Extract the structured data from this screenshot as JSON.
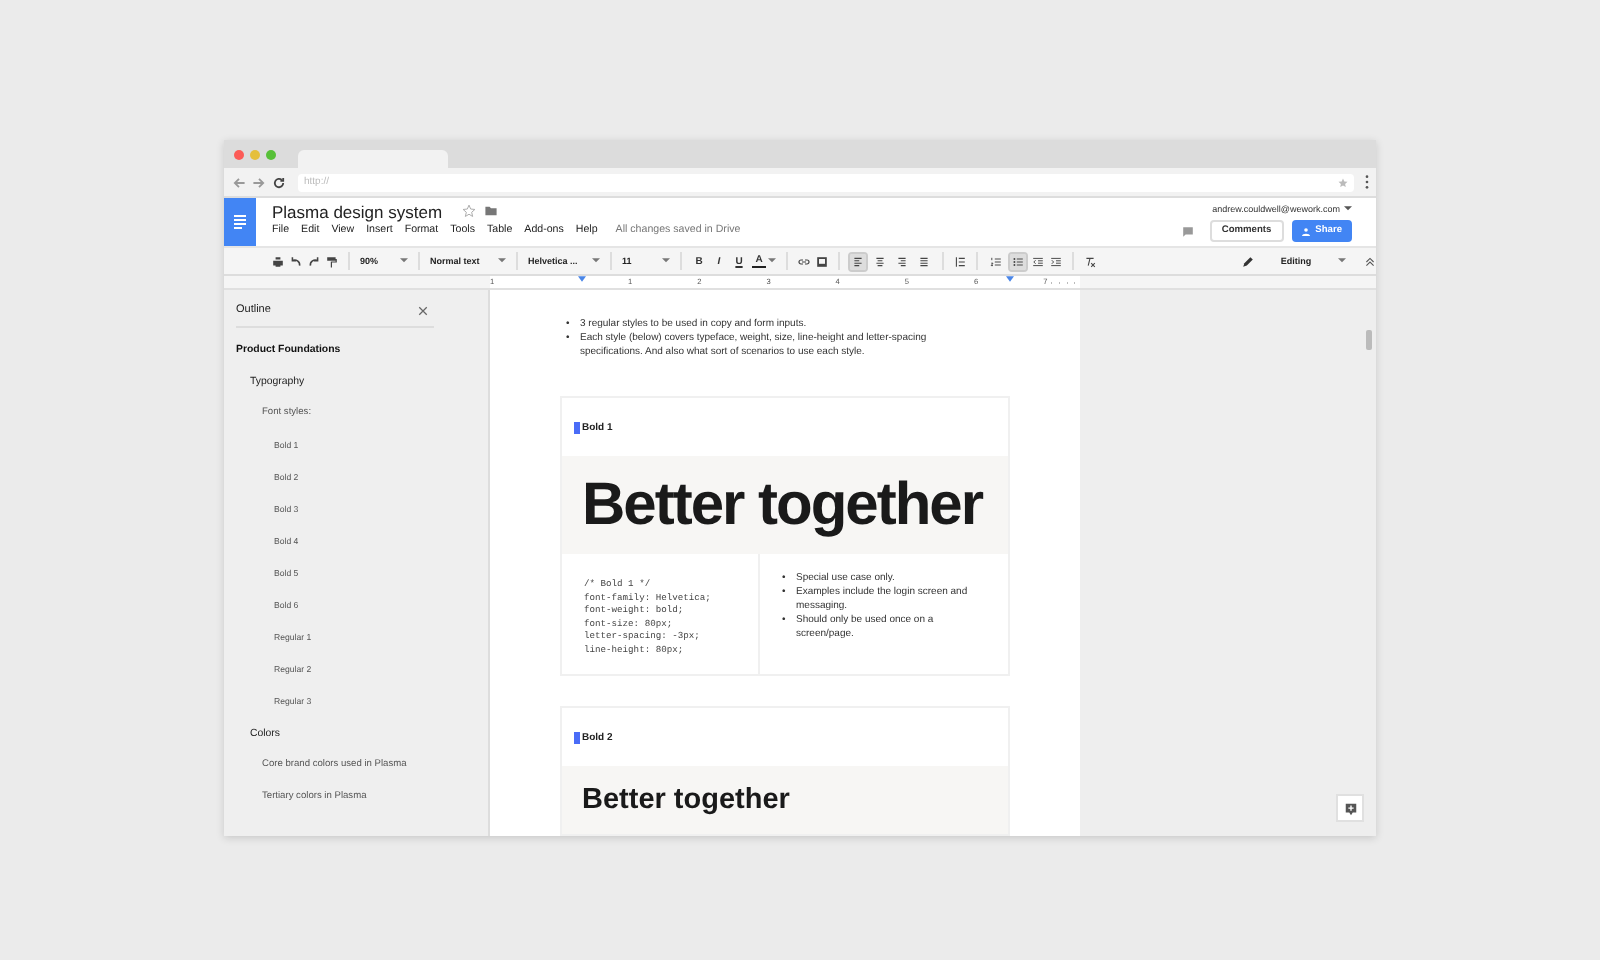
{
  "browser": {
    "url": "http://"
  },
  "header": {
    "title": "Plasma design system",
    "menu": [
      "File",
      "Edit",
      "View",
      "Insert",
      "Format",
      "Tools",
      "Table",
      "Add-ons",
      "Help"
    ],
    "save_status": "All changes saved in Drive",
    "account": "andrew.couldwell@wework.com",
    "comments_button": "Comments",
    "share_button": "Share"
  },
  "toolbar": {
    "zoom": "90%",
    "style": "Normal text",
    "font": "Helvetica ...",
    "size": "11",
    "format": [
      "B",
      "I",
      "U",
      "A"
    ],
    "align": [
      {
        "selected": true
      },
      {
        "selected": false
      },
      {
        "selected": false
      },
      {
        "selected": false
      }
    ],
    "lists": [
      {
        "kind": "numbered",
        "selected": false
      },
      {
        "kind": "bulleted",
        "selected": true
      }
    ],
    "mode": "Editing"
  },
  "ruler": {
    "numbers": [
      "1",
      "1",
      "2",
      "3",
      "4",
      "5",
      "6",
      "7"
    ]
  },
  "outline": {
    "title": "Outline",
    "items": [
      {
        "label": "Product Foundations",
        "children": [
          {
            "label": "Typography",
            "children": [
              {
                "label": "Font styles:",
                "children": [
                  {
                    "label": "Bold 1"
                  },
                  {
                    "label": "Bold 2"
                  },
                  {
                    "label": "Bold 3"
                  },
                  {
                    "label": "Bold 4"
                  },
                  {
                    "label": "Bold 5"
                  },
                  {
                    "label": "Bold 6"
                  },
                  {
                    "label": "Regular 1"
                  },
                  {
                    "label": "Regular 2"
                  },
                  {
                    "label": "Regular 3"
                  }
                ]
              }
            ]
          },
          {
            "label": "Colors",
            "children": [
              {
                "label": "Core brand colors used in Plasma"
              },
              {
                "label": "Tertiary colors in Plasma"
              }
            ]
          }
        ]
      }
    ]
  },
  "document": {
    "bullet_marker": "•",
    "bullets": [
      "3 regular styles to be used in copy and form inputs.",
      "Each style (below) covers typeface, weight, size, line-height and letter-spacing specifications. And also what sort of scenarios to use each style."
    ],
    "cards": [
      {
        "label": "Bold 1",
        "kind": "large",
        "sample": "Better together",
        "code": [
          "/* Bold 1 */",
          "font-family: Helvetica;",
          "font-weight: bold;",
          "font-size: 80px;",
          "letter-spacing: -3px;",
          "line-height: 80px;"
        ],
        "notes": [
          "Special use case only.",
          "Examples include the login screen and messaging.",
          "Should only be used once on a screen/page."
        ]
      },
      {
        "label": "Bold 2",
        "kind": "medium",
        "sample": "Better together"
      }
    ]
  }
}
